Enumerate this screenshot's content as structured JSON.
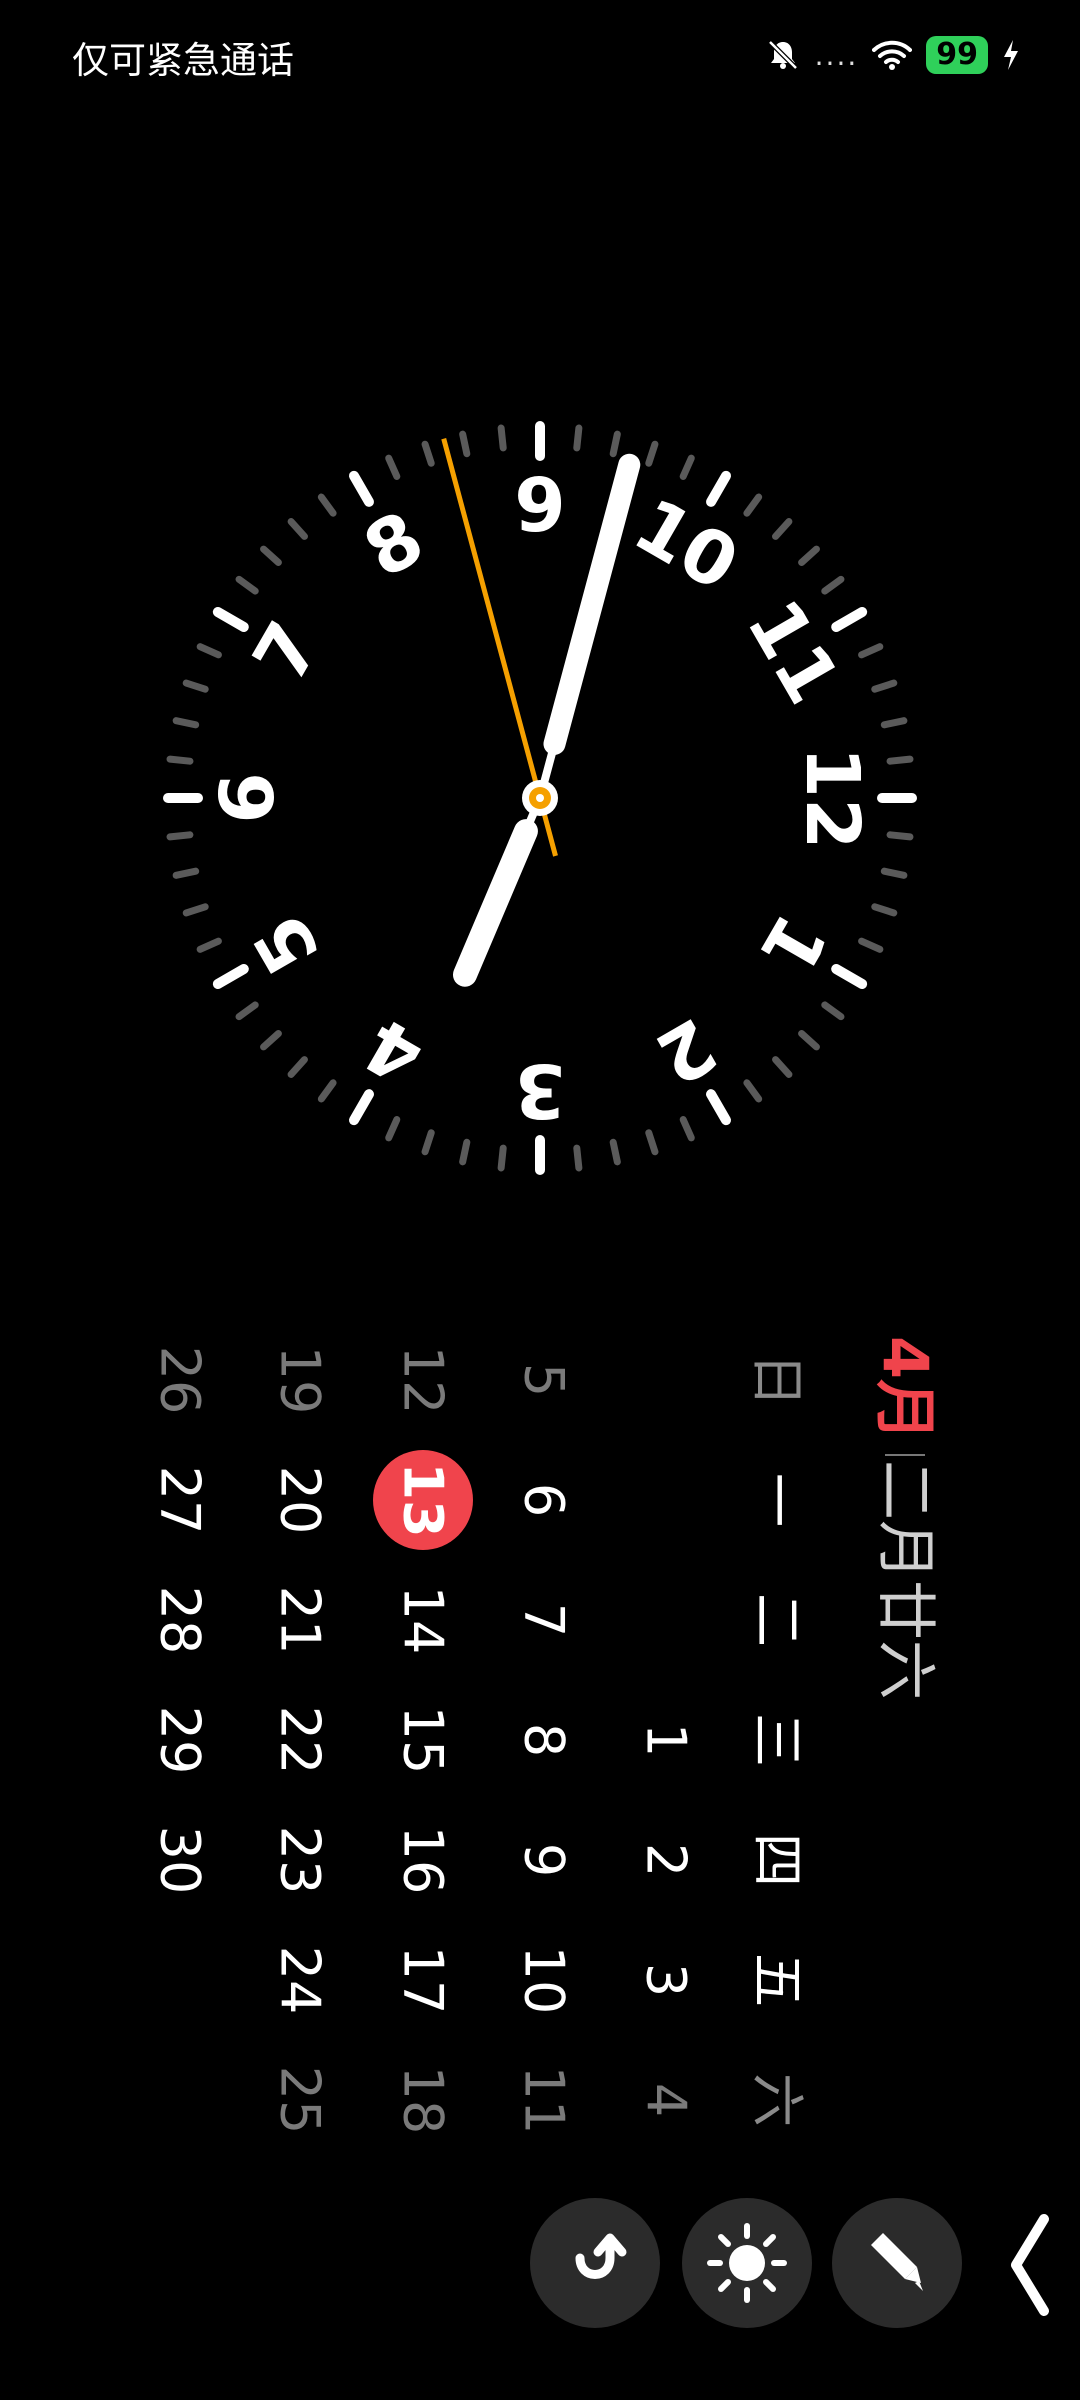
{
  "status_bar": {
    "carrier_text": "仅可紧急通话",
    "signal_text": "....",
    "battery": "99"
  },
  "clock": {
    "numerals": [
      "12",
      "1",
      "2",
      "3",
      "4",
      "5",
      "6",
      "7",
      "8",
      "9",
      "10",
      "11"
    ],
    "hour_hand_angle": 203,
    "minute_hand_angle": 15,
    "second_hand_angle": 345,
    "second_hand_color": "#f5a000",
    "dial_rotation": 90
  },
  "calendar": {
    "month": "4月",
    "lunar_date": "二月廿六",
    "weekday_headers": [
      "日",
      "一",
      "二",
      "三",
      "四",
      "五",
      "六"
    ],
    "today": "13",
    "today_color": "#f0444c",
    "weeks": [
      [
        "",
        "",
        "",
        "1",
        "2",
        "3",
        "4"
      ],
      [
        "5",
        "6",
        "7",
        "8",
        "9",
        "10",
        "11"
      ],
      [
        "12",
        "13",
        "14",
        "15",
        "16",
        "17",
        "18"
      ],
      [
        "19",
        "20",
        "21",
        "22",
        "23",
        "24",
        "25"
      ],
      [
        "26",
        "27",
        "28",
        "29",
        "30",
        "",
        ""
      ]
    ]
  },
  "controls": {
    "rotate": "rotate-icon",
    "brightness": "sun-icon",
    "edit": "pen-icon",
    "back": "chevron-left-icon"
  },
  "colors": {
    "background": "#000000",
    "accent_red": "#f0444c",
    "accent_orange": "#f5a000",
    "weekend_gray": "#8a8a8a"
  }
}
